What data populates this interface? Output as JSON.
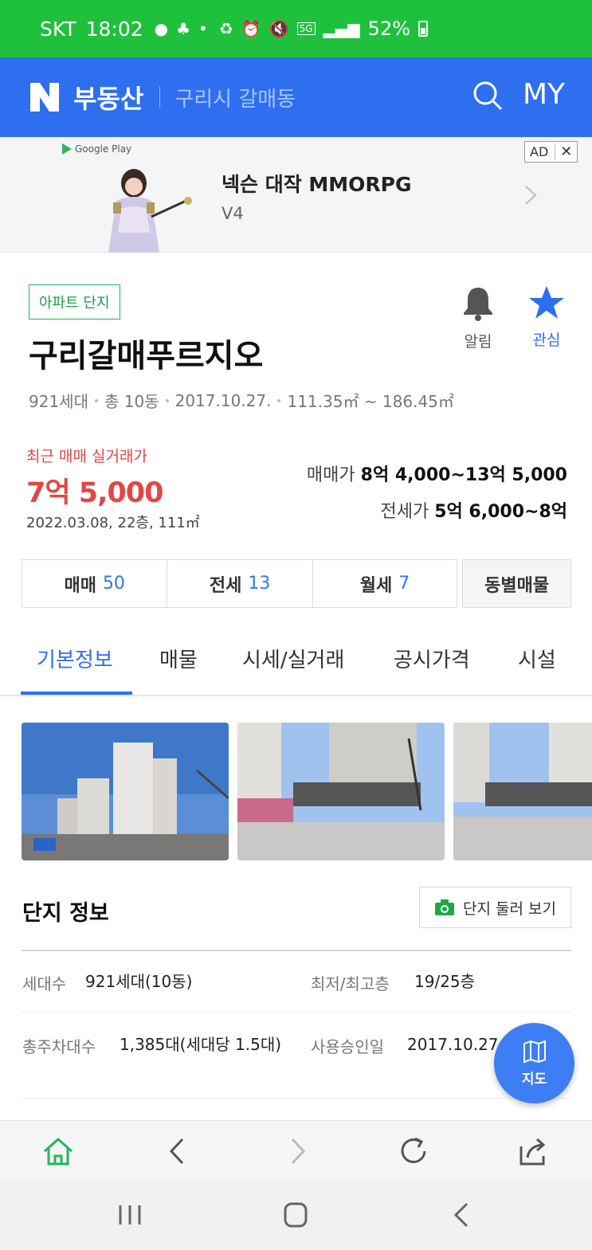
{
  "status_bar": {
    "carrier": "SKT",
    "time": "18:02",
    "network": "5G",
    "battery": "52%"
  },
  "header": {
    "brand": "부동산",
    "location": "구리시 갈매동",
    "my_label": "MY"
  },
  "ad": {
    "store": "Google Play",
    "title": "넥슨 대작 MMORPG",
    "subtitle": "V4",
    "badge": "AD",
    "close": "✕"
  },
  "complex": {
    "type_badge": "아파트 단지",
    "name": "구리갈매푸르지오",
    "alarm_label": "알림",
    "fav_label": "관심",
    "meta": [
      "921세대",
      "총 10동",
      "2017.10.27.",
      "111.35㎡ ~ 186.45㎡"
    ]
  },
  "price": {
    "recent_label": "최근 매매 실거래가",
    "recent_value": "7억 5,000",
    "recent_meta": "2022.03.08, 22층, 111㎡",
    "sale_label": "매매가",
    "sale_value": "8억 4,000~13억 5,000",
    "jeonse_label": "전세가",
    "jeonse_value": "5억 6,000~8억"
  },
  "counts": [
    {
      "label": "매매",
      "num": "50"
    },
    {
      "label": "전세",
      "num": "13"
    },
    {
      "label": "월세",
      "num": "7"
    }
  ],
  "counts_by_building": "동별매물",
  "tabs": [
    "기본정보",
    "매물",
    "시세/실거래",
    "공시가격",
    "시설"
  ],
  "info": {
    "title": "단지 정보",
    "tour_label": "단지 둘러 보기",
    "rows": [
      {
        "l1": "세대수",
        "v1": "921세대(10동)",
        "l2": "최저/최고층",
        "v2": "19/25층"
      },
      {
        "l1": "총주차대수",
        "v1": "1,385대(세대당 1.5대)",
        "l2": "사용승인일",
        "v2": "2017.10.27"
      }
    ]
  },
  "map_fab": {
    "label": "지도"
  },
  "colors": {
    "status_green": "#1fc13c",
    "brand_blue": "#2e6ff0",
    "price_red": "#e04747",
    "count_blue": "#2e7ae6"
  }
}
